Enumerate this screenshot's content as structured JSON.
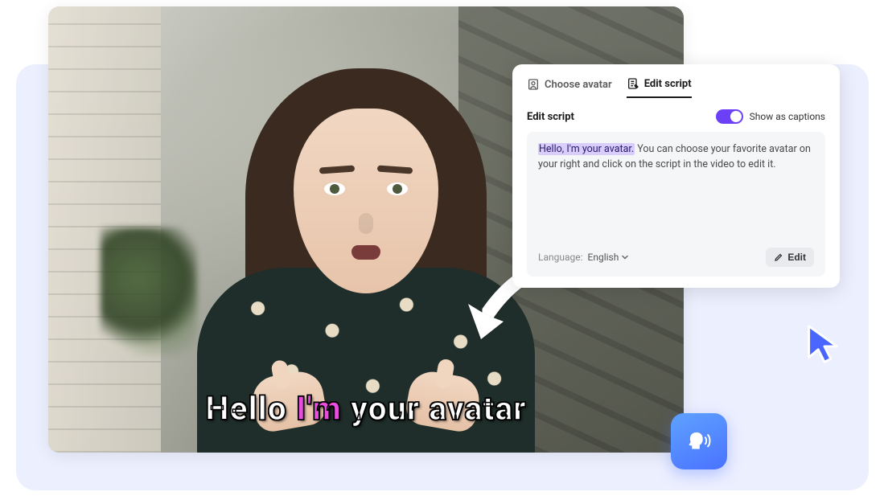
{
  "tabs": {
    "choose_avatar": "Choose avatar",
    "edit_script": "Edit script"
  },
  "panel": {
    "section_label": "Edit script",
    "toggle_label": "Show as captions",
    "script_highlight": "Hello, I'm your avatar.",
    "script_rest": " You can choose your favorite avatar on your right and click on the script in the video to edit it.",
    "language_label": "Language:",
    "language_value": "English",
    "edit_button": "Edit"
  },
  "caption": {
    "w1": "Hello",
    "w2": "I'm",
    "w3": "your",
    "w4": "avatar"
  },
  "colors": {
    "accent": "#6C40F7",
    "caption_highlight": "#E84DE0",
    "badge_gradient_start": "#5EA2FF",
    "badge_gradient_end": "#4A72FF"
  }
}
